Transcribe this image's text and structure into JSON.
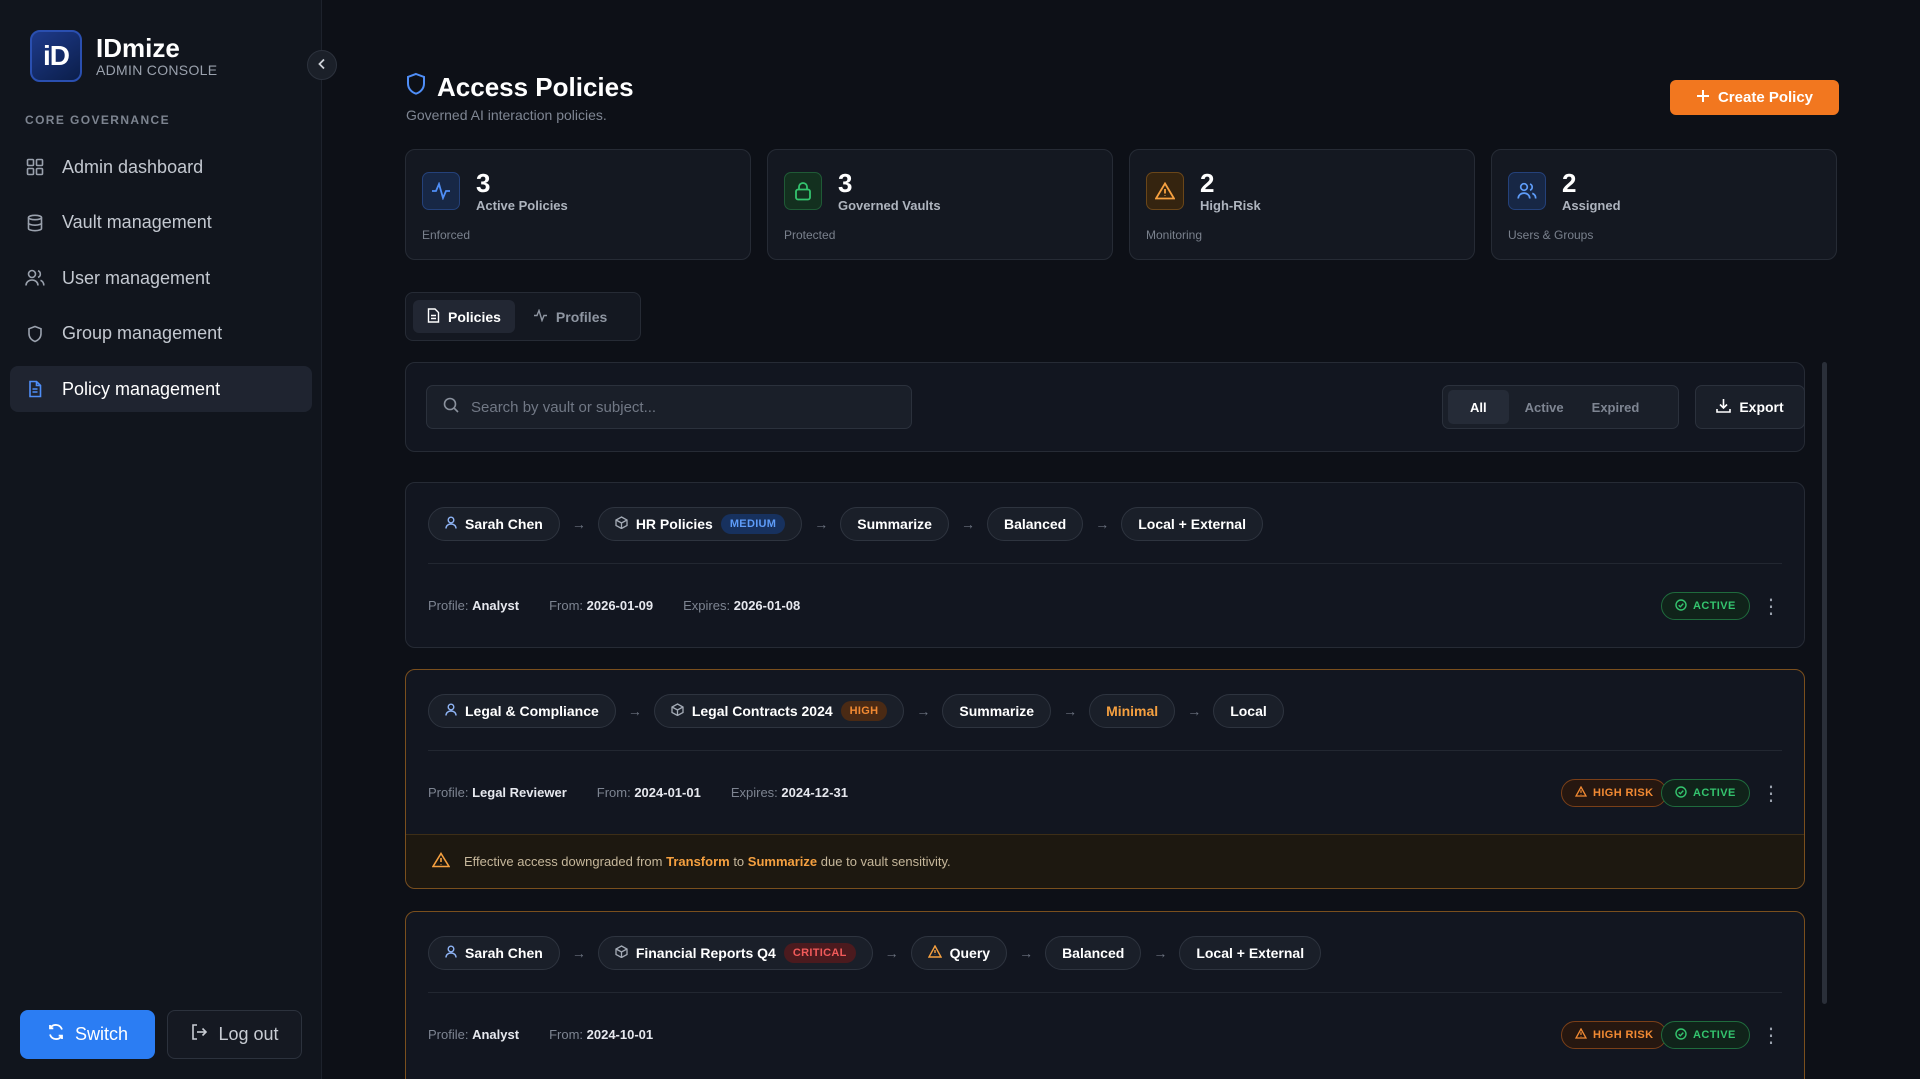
{
  "brand": {
    "logo_text": "iD",
    "name": "IDmize",
    "subtitle": "ADMIN CONSOLE"
  },
  "sidebar": {
    "section_label": "CORE GOVERNANCE",
    "items": [
      {
        "label": "Admin dashboard",
        "icon": "grid-icon",
        "active": false
      },
      {
        "label": "Vault management",
        "icon": "database-icon",
        "active": false
      },
      {
        "label": "User management",
        "icon": "users-icon",
        "active": false
      },
      {
        "label": "Group management",
        "icon": "shield-icon",
        "active": false
      },
      {
        "label": "Policy management",
        "icon": "document-icon",
        "active": true
      }
    ],
    "switch_label": "Switch",
    "logout_label": "Log out"
  },
  "page": {
    "title": "Access Policies",
    "subtitle": "Governed AI interaction policies.",
    "create_label": "Create Policy"
  },
  "stats": [
    {
      "value": "3",
      "label": "Active Policies",
      "foot": "Enforced",
      "icon": "activity-icon",
      "color": "#4f8ef7"
    },
    {
      "value": "3",
      "label": "Governed Vaults",
      "foot": "Protected",
      "icon": "lock-icon",
      "color": "#34c46e"
    },
    {
      "value": "2",
      "label": "High-Risk",
      "foot": "Monitoring",
      "icon": "warning-icon",
      "color": "#f5a040"
    },
    {
      "value": "2",
      "label": "Assigned",
      "foot": "Users & Groups",
      "icon": "users-icon",
      "color": "#5e9cf8"
    }
  ],
  "tabs": {
    "policies": "Policies",
    "profiles": "Profiles"
  },
  "toolbar": {
    "search_placeholder": "Search by vault or subject...",
    "filters": {
      "all": "All",
      "active": "Active",
      "expired": "Expired"
    },
    "export_label": "Export"
  },
  "policies": [
    {
      "subject": "Sarah Chen",
      "vault": "HR Policies",
      "sensitivity": "MEDIUM",
      "action": "Summarize",
      "mode": "Balanced",
      "scope": "Local + External",
      "profile_label": "Profile:",
      "profile": "Analyst",
      "from_label": "From:",
      "from": "2026-01-09",
      "expires_label": "Expires:",
      "expires": "2026-01-08",
      "status": "ACTIVE"
    },
    {
      "subject": "Legal & Compliance",
      "vault": "Legal Contracts 2024",
      "sensitivity": "HIGH",
      "action": "Summarize",
      "mode": "Minimal",
      "scope": "Local",
      "profile_label": "Profile:",
      "profile": "Legal Reviewer",
      "from_label": "From:",
      "from": "2024-01-01",
      "expires_label": "Expires:",
      "expires": "2024-12-31",
      "risk": "HIGH RISK",
      "status": "ACTIVE",
      "warning": {
        "pre": "Effective access downgraded from",
        "from_action": "Transform",
        "mid": "to",
        "to_action": "Summarize",
        "post": "due to vault sensitivity."
      }
    },
    {
      "subject": "Sarah Chen",
      "vault": "Financial Reports Q4",
      "sensitivity": "CRITICAL",
      "action": "Query",
      "mode": "Balanced",
      "scope": "Local + External",
      "profile_label": "Profile:",
      "profile": "Analyst",
      "from_label": "From:",
      "from": "2024-10-01",
      "risk": "HIGH RISK",
      "status": "ACTIVE"
    }
  ]
}
